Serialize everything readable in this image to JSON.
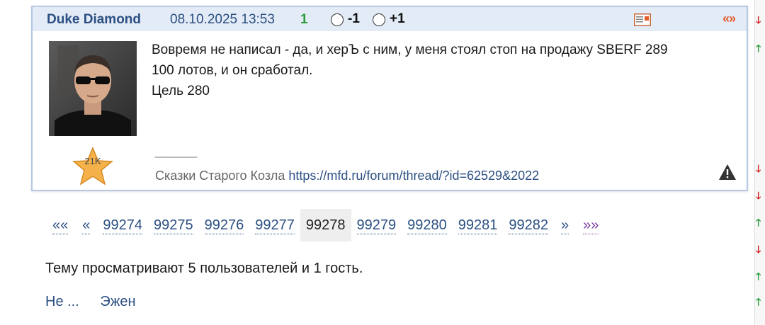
{
  "post": {
    "author": "Duke Diamond",
    "datetime": "08.10.2025 13:53",
    "score": "1",
    "vote_minus": "-1",
    "vote_plus": "+1",
    "nav_label": "«»",
    "avatar_rating": "21K",
    "text_lines": [
      "Вовремя не написал - да, и херЪ с ним, у меня стоял стоп на продажу SBERF 289",
      "100 лотов, и он сработал.",
      "Цель 280"
    ],
    "signature_divider": "--------------------",
    "signature_text": "Сказки Старого Козла",
    "signature_link": "https://mfd.ru/forum/thread/?id=62529&2022"
  },
  "pagination": {
    "first": "««",
    "prev": "«",
    "pages": [
      "99274",
      "99275",
      "99276",
      "99277",
      "99278",
      "99279",
      "99280",
      "99281",
      "99282"
    ],
    "current": "99278",
    "next": "»",
    "last": "»»"
  },
  "viewers_text": "Тему просматривают 5 пользователей и 1 гость.",
  "users": [
    "Не ...",
    "Эжен"
  ],
  "colors": {
    "header_bg": "#e3ebf7",
    "link": "#2b4f82",
    "score_green": "#2a9d3a",
    "nav_orange": "#e35a2b",
    "star": "#f6b24a"
  },
  "side_strip_arrows": [
    "down",
    "up",
    "down",
    "down",
    "up",
    "down",
    "up",
    "up"
  ]
}
